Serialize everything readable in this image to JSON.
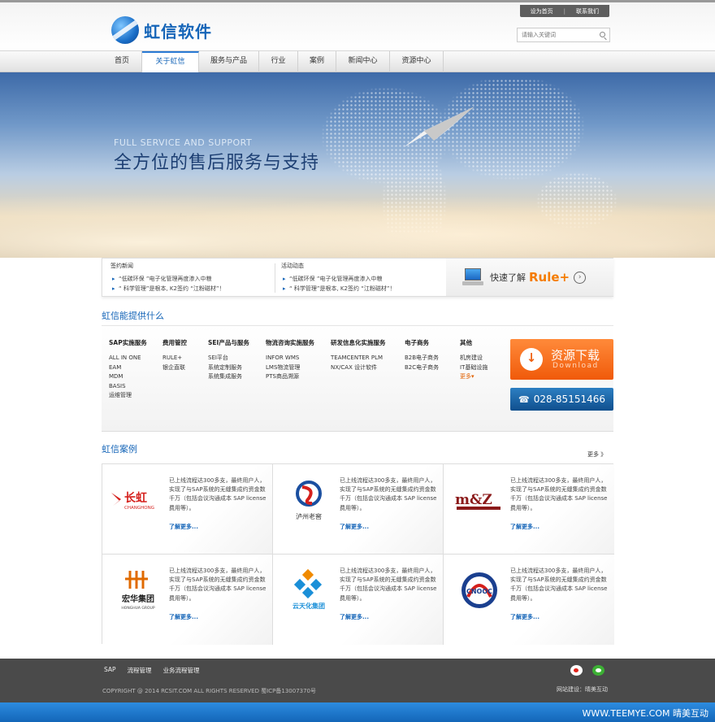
{
  "header": {
    "brand": "虹信软件",
    "top_links": [
      "设为首页",
      "联系我们"
    ],
    "top_sep": "|",
    "search_placeholder": "请输入关键词"
  },
  "nav": [
    {
      "label": "首页"
    },
    {
      "label": "关于虹信"
    },
    {
      "label": "服务与产品"
    },
    {
      "label": "行业"
    },
    {
      "label": "案例"
    },
    {
      "label": "新闻中心"
    },
    {
      "label": "资源中心"
    }
  ],
  "banner": {
    "subtitle": "FULL SERVICE AND SUPPORT",
    "title": "全方位的售后服务与支持"
  },
  "news": {
    "signed": {
      "title": "签约新闻",
      "items": [
        "“低碳环保 ”电子化管理再度渗入中粮",
        "“ 科学管理”是根本, K2签约 “江粉磁材”！"
      ]
    },
    "events": {
      "title": "活动动态",
      "items": [
        "“低碳环保 ”电子化管理再度渗入中粮",
        "“ 科学管理”是根本, K2签约 “江粉磁材”！"
      ]
    },
    "quick_text": "快速了解",
    "quick_product": "Rule+"
  },
  "services": {
    "title": "虹信能提供什么",
    "columns": [
      {
        "title": "SAP实施服务",
        "items": [
          "ALL IN ONE",
          "EAM",
          "MDM",
          "BASIS",
          "运维管理"
        ]
      },
      {
        "title": "费用管控",
        "items": [
          "RULE+",
          "银企直联"
        ]
      },
      {
        "title": "SEI产品与服务",
        "items": [
          "SEI平台",
          "系统定制服务",
          "系统集成服务"
        ]
      },
      {
        "title": "物流咨询实施服务",
        "items": [
          "INFOR WMS",
          "LMS物流管理",
          "PTS商品溯源"
        ]
      },
      {
        "title": "研发信息化实施服务",
        "items": [
          "TEAMCENTER PLM",
          "NX/CAX 设计软件"
        ]
      },
      {
        "title": "电子商务",
        "items": [
          "B2B电子商务",
          "B2C电子商务"
        ]
      },
      {
        "title": "其他",
        "items": [
          "机房建设",
          "IT基础设施"
        ],
        "more": "更多▾"
      }
    ],
    "download_title": "资源下载",
    "download_sub": "Download",
    "phone": "028-85151466"
  },
  "cases": {
    "title": "虹信案例",
    "more": "更多 》",
    "items": [
      {
        "logo": "长虹",
        "logo_sub": "CHANGHONG",
        "desc": "已上线流程达300多支，最终用户人，实现了与SAP系统的无缝集成约资金数千万（包括会议沟通成本 SAP license费用等）。",
        "more": "了解更多..."
      },
      {
        "logo": "泸州老窖",
        "logo_sub": "",
        "desc": "已上线流程达300多支，最终用户人，实现了与SAP系统的无缝集成约资金数千万（包括会议沟通成本 SAP license费用等）。",
        "more": "了解更多..."
      },
      {
        "logo": "m&Z",
        "logo_sub": "",
        "desc": "已上线流程达300多支，最终用户人，实现了与SAP系统的无缝集成约资金数千万（包括会议沟通成本 SAP license费用等）。",
        "more": "了解更多..."
      },
      {
        "logo": "宏华集团",
        "logo_sub": "HONGHUA GROUP",
        "desc": "已上线流程达300多支，最终用户人，实现了与SAP系统的无缝集成约资金数千万（包括会议沟通成本 SAP license费用等）。",
        "more": "了解更多..."
      },
      {
        "logo": "云天化集团",
        "logo_sub": "",
        "desc": "已上线流程达300多支，最终用户人，实现了与SAP系统的无缝集成约资金数千万（包括会议沟通成本 SAP license费用等）。",
        "more": "了解更多..."
      },
      {
        "logo": "CNOOC",
        "logo_sub": "",
        "desc": "已上线流程达300多支，最终用户人，实现了与SAP系统的无缝集成约资金数千万（包括会议沟通成本 SAP license费用等）。",
        "more": "了解更多..."
      }
    ]
  },
  "footer": {
    "links": [
      "SAP",
      "流程管理",
      "业务流程管理"
    ],
    "copyright": "COPYRIGHT @ 2014 RCSIT.COM ALL RIGHTS RESERVED   蜀ICP备13007370号",
    "build": "网站建设：晴美互动",
    "bottom_brand": "WWW.TEEMYE.COM  晴美互动"
  },
  "colors": {
    "accent": "#1565b8",
    "orange": "#f05a0a",
    "footer": "#4a4a4a",
    "bottom": "#1366b8"
  }
}
